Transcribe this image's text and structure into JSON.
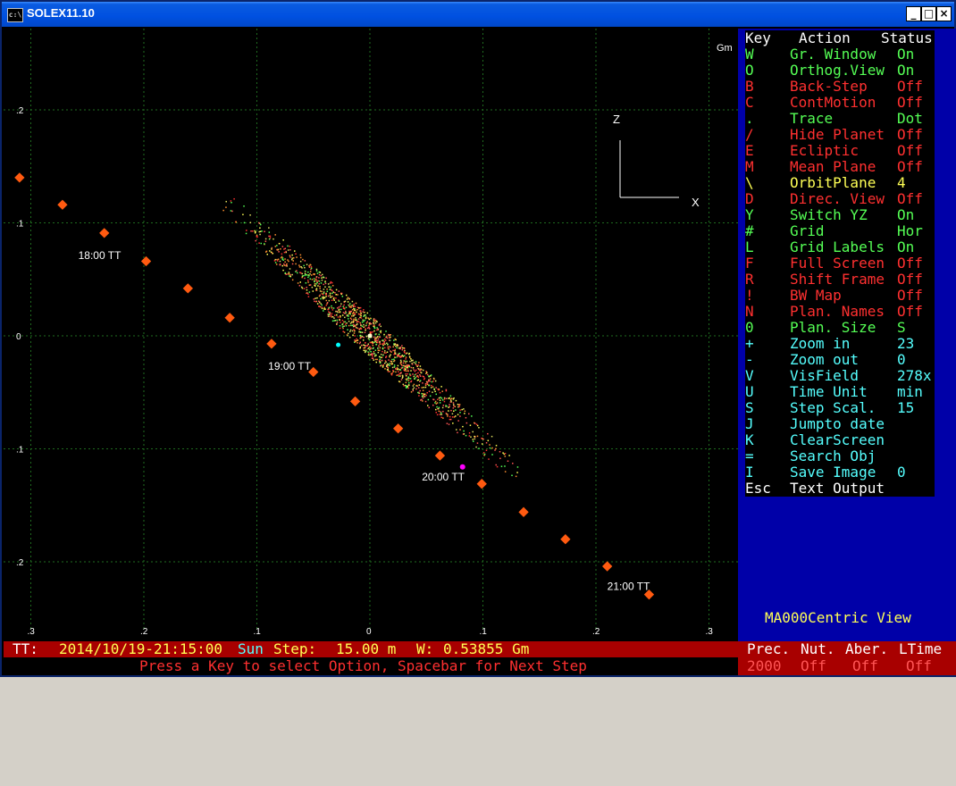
{
  "window": {
    "title": "SOLEX11.10",
    "icon_text": "c:\\",
    "minimize": "_",
    "maximize": "□",
    "close": "×"
  },
  "plot": {
    "unit_label": "Gm",
    "x_ticks": [
      {
        "label": ".3",
        "value": -0.3
      },
      {
        "label": ".2",
        "value": -0.2
      },
      {
        "label": ".1",
        "value": -0.1
      },
      {
        "label": "0",
        "value": 0
      },
      {
        "label": ".1",
        "value": 0.1
      },
      {
        "label": ".2",
        "value": 0.2
      },
      {
        "label": ".3",
        "value": 0.3
      }
    ],
    "y_ticks": [
      {
        "label": ".2",
        "value": 0.2
      },
      {
        "label": ".1",
        "value": 0.1
      },
      {
        "label": "0",
        "value": 0
      },
      {
        "label": ".1",
        "value": -0.1
      },
      {
        "label": ".2",
        "value": -0.2
      }
    ],
    "axis_z": "Z",
    "axis_x": "X",
    "time_labels": [
      {
        "text": "18:00 TT",
        "x": -0.258,
        "y": 0.068
      },
      {
        "text": "19:00 TT",
        "x": -0.09,
        "y": -0.03
      },
      {
        "text": "20:00 TT",
        "x": 0.046,
        "y": -0.128
      },
      {
        "text": "21:00 TT",
        "x": 0.21,
        "y": -0.225
      }
    ],
    "track_points": [
      {
        "x": -0.31,
        "y": 0.14
      },
      {
        "x": -0.272,
        "y": 0.116
      },
      {
        "x": -0.235,
        "y": 0.091
      },
      {
        "x": -0.198,
        "y": 0.066
      },
      {
        "x": -0.161,
        "y": 0.042
      },
      {
        "x": -0.124,
        "y": 0.016
      },
      {
        "x": -0.087,
        "y": -0.007
      },
      {
        "x": -0.05,
        "y": -0.032
      },
      {
        "x": -0.013,
        "y": -0.058
      },
      {
        "x": 0.025,
        "y": -0.082
      },
      {
        "x": 0.062,
        "y": -0.106
      },
      {
        "x": 0.099,
        "y": -0.131
      },
      {
        "x": 0.136,
        "y": -0.156
      },
      {
        "x": 0.173,
        "y": -0.18
      },
      {
        "x": 0.21,
        "y": -0.204
      },
      {
        "x": 0.247,
        "y": -0.229
      }
    ],
    "cyan_dot": {
      "x": -0.028,
      "y": -0.008
    },
    "magenta_dot": {
      "x": 0.082,
      "y": -0.116
    },
    "center_dot": {
      "x": 0.0,
      "y": 0.0
    },
    "colors": {
      "grid": "#1f6b1f",
      "track": "#ff5a10",
      "cyan": "#00ffff",
      "magenta": "#ff00ff",
      "label": "#ffffff",
      "axis": "#ffffff"
    }
  },
  "menu": {
    "header": {
      "key": "Key",
      "action": "Action",
      "status": "Status"
    },
    "items": [
      {
        "key": "W",
        "action": "Gr. Window",
        "status": "On",
        "color": "#55ff55"
      },
      {
        "key": "O",
        "action": "Orthog.View",
        "status": "On",
        "color": "#55ff55"
      },
      {
        "key": "B",
        "action": "Back-Step",
        "status": "Off",
        "color": "#ff3030"
      },
      {
        "key": "C",
        "action": "ContMotion",
        "status": "Off",
        "color": "#ff3030"
      },
      {
        "key": ".",
        "action": "Trace",
        "status": "Dot",
        "color": "#55ff55"
      },
      {
        "key": "/",
        "action": "Hide Planet",
        "status": "Off",
        "color": "#ff3030"
      },
      {
        "key": "E",
        "action": "Ecliptic",
        "status": "Off",
        "color": "#ff3030"
      },
      {
        "key": "M",
        "action": "Mean Plane",
        "status": "Off",
        "color": "#ff3030"
      },
      {
        "key": "\\",
        "action": "OrbitPlane",
        "status": "4",
        "color": "#ffff55"
      },
      {
        "key": "D",
        "action": "Direc. View",
        "status": "Off",
        "color": "#ff3030"
      },
      {
        "key": "Y",
        "action": "Switch YZ",
        "status": "On",
        "color": "#55ff55"
      },
      {
        "key": "#",
        "action": "Grid",
        "status": "Hor",
        "color": "#55ff55"
      },
      {
        "key": "L",
        "action": "Grid Labels",
        "status": "On",
        "color": "#55ff55"
      },
      {
        "key": "F",
        "action": "Full Screen",
        "status": "Off",
        "color": "#ff3030"
      },
      {
        "key": "R",
        "action": "Shift Frame",
        "status": "Off",
        "color": "#ff3030"
      },
      {
        "key": "!",
        "action": "BW Map",
        "status": "Off",
        "color": "#ff3030"
      },
      {
        "key": "N",
        "action": "Plan. Names",
        "status": "Off",
        "color": "#ff3030"
      },
      {
        "key": "0",
        "action": "Plan. Size",
        "status": "S",
        "color": "#55ff55"
      },
      {
        "key": "+",
        "action": "Zoom in",
        "status": "23",
        "color": "#55ffff"
      },
      {
        "key": "-",
        "action": "Zoom out",
        "status": "0",
        "color": "#55ffff"
      },
      {
        "key": "V",
        "action": "VisField",
        "status": "278x",
        "color": "#55ffff"
      },
      {
        "key": "U",
        "action": "Time Unit",
        "status": "min",
        "color": "#55ffff"
      },
      {
        "key": "S",
        "action": "Step Scal.",
        "status": "15",
        "color": "#55ffff"
      },
      {
        "key": "J",
        "action": "Jumpto date",
        "status": "",
        "color": "#55ffff"
      },
      {
        "key": "K",
        "action": "ClearScreen",
        "status": "",
        "color": "#55ffff"
      },
      {
        "key": "=",
        "action": "Search Obj",
        "status": "",
        "color": "#55ffff"
      },
      {
        "key": "I",
        "action": "Save Image",
        "status": "0",
        "color": "#55ffff"
      },
      {
        "key": "Esc",
        "action": "Text Output",
        "status": "",
        "color": "#ffffff"
      }
    ],
    "centric_view": "MA000Centric View"
  },
  "status": {
    "tt_label": "TT:",
    "datetime": "2014/10/19-21:15:00",
    "center": "Sun",
    "step_label": "Step:",
    "step_value": "15.00 m",
    "w_label": "W:",
    "w_value": "0.53855 Gm",
    "prompt": "Press a Key to select Option, Spacebar for Next Step"
  },
  "prec_panel": {
    "headers": [
      "Prec.",
      "Nut.",
      "Aber.",
      "LTime"
    ],
    "values": [
      "2000",
      "Off",
      "Off",
      "Off"
    ]
  }
}
